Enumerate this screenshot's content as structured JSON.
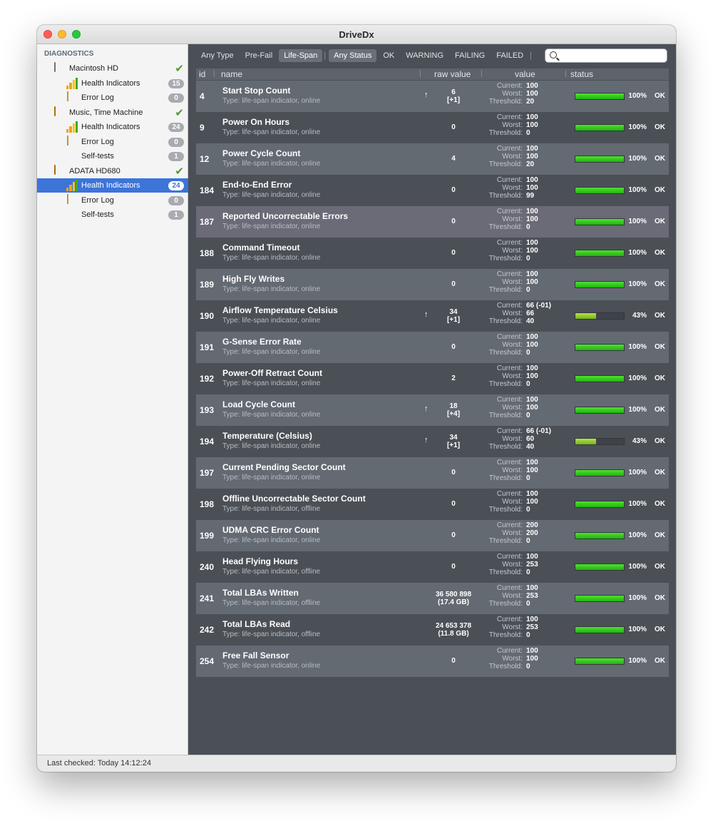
{
  "window": {
    "title": "DriveDx"
  },
  "sidebar": {
    "header": "DIAGNOSTICS",
    "items": [
      {
        "label": "Macintosh HD",
        "icon": "drive-icon",
        "level": 0,
        "check": true
      },
      {
        "label": "Health Indicators",
        "icon": "health-chart-icon",
        "level": 1,
        "badge": "15"
      },
      {
        "label": "Error Log",
        "icon": "log-icon",
        "level": 1,
        "badge": "0"
      },
      {
        "label": "Music, Time Machine",
        "icon": "external-drive-icon",
        "level": 0,
        "check": true
      },
      {
        "label": "Health Indicators",
        "icon": "health-chart-icon",
        "level": 1,
        "badge": "24"
      },
      {
        "label": "Error Log",
        "icon": "log-icon",
        "level": 1,
        "badge": "0"
      },
      {
        "label": "Self-tests",
        "icon": "self-test-icon",
        "level": 1,
        "badge": "1"
      },
      {
        "label": "ADATA HD680",
        "icon": "external-drive-icon",
        "level": 0,
        "check": true
      },
      {
        "label": "Health Indicators",
        "icon": "health-chart-icon",
        "level": 1,
        "badge": "24",
        "selected": true
      },
      {
        "label": "Error Log",
        "icon": "log-icon",
        "level": 1,
        "badge": "0"
      },
      {
        "label": "Self-tests",
        "icon": "self-test-icon",
        "level": 1,
        "badge": "1"
      }
    ]
  },
  "filters": {
    "type": [
      "Any Type",
      "Pre-Fail",
      "Life-Span"
    ],
    "type_active": "Life-Span",
    "status": [
      "Any Status",
      "OK",
      "WARNING",
      "FAILING",
      "FAILED"
    ],
    "status_active": "Any Status",
    "search_placeholder": ""
  },
  "columns": {
    "id": "id",
    "name": "name",
    "raw": "raw value",
    "value": "value",
    "status": "status"
  },
  "labels": {
    "current": "Current:",
    "worst": "Worst:",
    "threshold": "Threshold:"
  },
  "colors": {
    "selection": "#3d74d8",
    "bar_ok": "#2fc41a",
    "bar_partial": "#8dc52b",
    "check": "#4f9a2a"
  },
  "rows": [
    {
      "id": "4",
      "name": "Start Stop Count",
      "type": "Type: life-span indicator, online",
      "raw": "6",
      "raw_delta": "[+1]",
      "arrow": "↑",
      "current": "100",
      "worst": "100",
      "threshold": "20",
      "percent": 100,
      "percent_label": "100%",
      "status": "OK"
    },
    {
      "id": "9",
      "name": "Power On Hours",
      "type": "Type: life-span indicator, online",
      "raw": "0",
      "current": "100",
      "worst": "100",
      "threshold": "0",
      "percent": 100,
      "percent_label": "100%",
      "status": "OK"
    },
    {
      "id": "12",
      "name": "Power Cycle Count",
      "type": "Type: life-span indicator, online",
      "raw": "4",
      "current": "100",
      "worst": "100",
      "threshold": "20",
      "percent": 100,
      "percent_label": "100%",
      "status": "OK"
    },
    {
      "id": "184",
      "name": "End-to-End Error",
      "type": "Type: life-span indicator, online",
      "raw": "0",
      "current": "100",
      "worst": "100",
      "threshold": "99",
      "percent": 100,
      "percent_label": "100%",
      "status": "OK"
    },
    {
      "id": "187",
      "name": "Reported Uncorrectable Errors",
      "type": "Type: life-span indicator, online",
      "raw": "0",
      "current": "100",
      "worst": "100",
      "threshold": "0",
      "percent": 100,
      "percent_label": "100%",
      "status": "OK",
      "highlight": true
    },
    {
      "id": "188",
      "name": "Command Timeout",
      "type": "Type: life-span indicator, online",
      "raw": "0",
      "current": "100",
      "worst": "100",
      "threshold": "0",
      "percent": 100,
      "percent_label": "100%",
      "status": "OK"
    },
    {
      "id": "189",
      "name": "High Fly Writes",
      "type": "Type: life-span indicator, online",
      "raw": "0",
      "current": "100",
      "worst": "100",
      "threshold": "0",
      "percent": 100,
      "percent_label": "100%",
      "status": "OK"
    },
    {
      "id": "190",
      "name": "Airflow Temperature Celsius",
      "type": "Type: life-span indicator, online",
      "raw": "34",
      "raw_delta": "[+1]",
      "arrow": "↑",
      "current": "66  (-01)",
      "worst": "66",
      "threshold": "40",
      "percent": 43,
      "percent_label": "43%",
      "status": "OK"
    },
    {
      "id": "191",
      "name": "G-Sense Error Rate",
      "type": "Type: life-span indicator, online",
      "raw": "0",
      "current": "100",
      "worst": "100",
      "threshold": "0",
      "percent": 100,
      "percent_label": "100%",
      "status": "OK"
    },
    {
      "id": "192",
      "name": "Power-Off Retract Count",
      "type": "Type: life-span indicator, online",
      "raw": "2",
      "current": "100",
      "worst": "100",
      "threshold": "0",
      "percent": 100,
      "percent_label": "100%",
      "status": "OK"
    },
    {
      "id": "193",
      "name": "Load Cycle Count",
      "type": "Type: life-span indicator, online",
      "raw": "18",
      "raw_delta": "[+4]",
      "arrow": "↑",
      "current": "100",
      "worst": "100",
      "threshold": "0",
      "percent": 100,
      "percent_label": "100%",
      "status": "OK"
    },
    {
      "id": "194",
      "name": "Temperature (Celsius)",
      "type": "Type: life-span indicator, online",
      "raw": "34",
      "raw_delta": "[+1]",
      "arrow": "↑",
      "current": "66  (-01)",
      "worst": "60",
      "threshold": "40",
      "percent": 43,
      "percent_label": "43%",
      "status": "OK"
    },
    {
      "id": "197",
      "name": "Current Pending Sector Count",
      "type": "Type: life-span indicator, online",
      "raw": "0",
      "current": "100",
      "worst": "100",
      "threshold": "0",
      "percent": 100,
      "percent_label": "100%",
      "status": "OK"
    },
    {
      "id": "198",
      "name": "Offline Uncorrectable Sector Count",
      "type": "Type: life-span indicator, offline",
      "raw": "0",
      "current": "100",
      "worst": "100",
      "threshold": "0",
      "percent": 100,
      "percent_label": "100%",
      "status": "OK"
    },
    {
      "id": "199",
      "name": "UDMA CRC Error Count",
      "type": "Type: life-span indicator, online",
      "raw": "0",
      "current": "200",
      "worst": "200",
      "threshold": "0",
      "percent": 100,
      "percent_label": "100%",
      "status": "OK"
    },
    {
      "id": "240",
      "name": "Head Flying Hours",
      "type": "Type: life-span indicator, offline",
      "raw": "0",
      "current": "100",
      "worst": "253",
      "threshold": "0",
      "percent": 100,
      "percent_label": "100%",
      "status": "OK"
    },
    {
      "id": "241",
      "name": "Total LBAs Written",
      "type": "Type: life-span indicator, offline",
      "raw": "36 580 898",
      "raw_delta": "(17.4 GB)",
      "current": "100",
      "worst": "253",
      "threshold": "0",
      "percent": 100,
      "percent_label": "100%",
      "status": "OK"
    },
    {
      "id": "242",
      "name": "Total LBAs Read",
      "type": "Type: life-span indicator, offline",
      "raw": "24 653 378",
      "raw_delta": "(11.8 GB)",
      "current": "100",
      "worst": "253",
      "threshold": "0",
      "percent": 100,
      "percent_label": "100%",
      "status": "OK"
    },
    {
      "id": "254",
      "name": "Free Fall Sensor",
      "type": "Type: life-span indicator, online",
      "raw": "0",
      "current": "100",
      "worst": "100",
      "threshold": "0",
      "percent": 100,
      "percent_label": "100%",
      "status": "OK"
    }
  ],
  "statusbar": {
    "text": "Last checked: Today 14:12:24"
  }
}
